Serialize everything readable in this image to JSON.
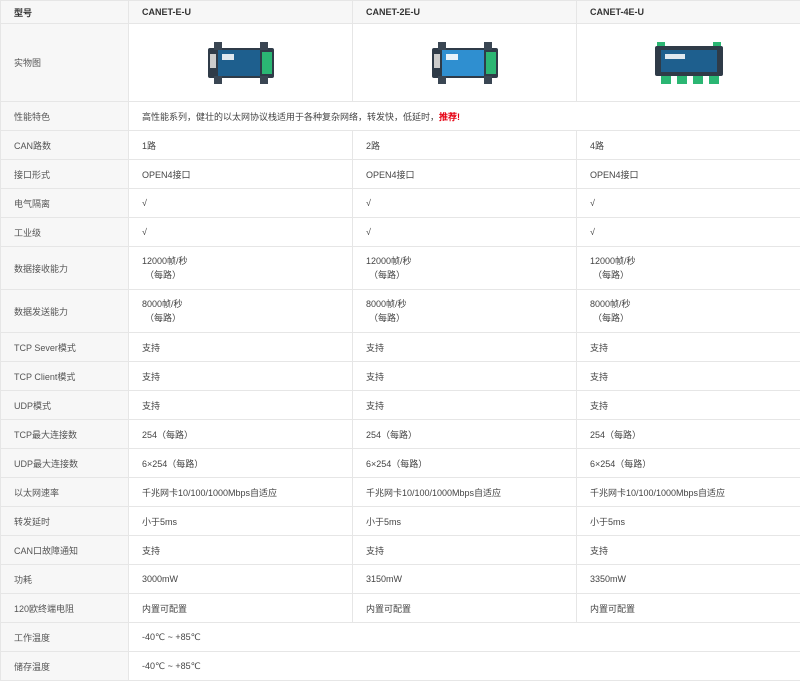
{
  "header": {
    "label": "型号",
    "models": [
      "CANET-E-U",
      "CANET-2E-U",
      "CANET-4E-U"
    ]
  },
  "rows": {
    "photo": {
      "label": "实物图"
    },
    "feature": {
      "label": "性能特色",
      "text": "高性能系列，健壮的以太网协议栈适用于各种复杂网络，转发快，低延时，",
      "highlight": "推荐!"
    },
    "can_channels": {
      "label": "CAN路数",
      "values": [
        "1路",
        "2路",
        "4路"
      ]
    },
    "interface": {
      "label": "接口形式",
      "values": [
        "OPEN4接口",
        "OPEN4接口",
        "OPEN4接口"
      ]
    },
    "isolation": {
      "label": "电气隔离",
      "values": [
        "√",
        "√",
        "√"
      ]
    },
    "industrial": {
      "label": "工业级",
      "values": [
        "√",
        "√",
        "√"
      ]
    },
    "rx": {
      "label": "数据接收能力",
      "values": [
        "12000帧/秒",
        "12000帧/秒",
        "12000帧/秒"
      ],
      "sub": "（每路）"
    },
    "tx": {
      "label": "数据发送能力",
      "values": [
        "8000帧/秒",
        "8000帧/秒",
        "8000帧/秒"
      ],
      "sub": "（每路）"
    },
    "tcp_server": {
      "label": "TCP Sever模式",
      "values": [
        "支持",
        "支持",
        "支持"
      ]
    },
    "tcp_client": {
      "label": "TCP Client模式",
      "values": [
        "支持",
        "支持",
        "支持"
      ]
    },
    "udp": {
      "label": "UDP模式",
      "values": [
        "支持",
        "支持",
        "支持"
      ]
    },
    "tcp_max": {
      "label": "TCP最大连接数",
      "values": [
        "254（每路）",
        "254（每路）",
        "254（每路）"
      ]
    },
    "udp_max": {
      "label": "UDP最大连接数",
      "values": [
        "6×254（每路）",
        "6×254（每路）",
        "6×254（每路）"
      ]
    },
    "eth_speed": {
      "label": "以太网速率",
      "values": [
        "千兆网卡10/100/1000Mbps自适应",
        "千兆网卡10/100/1000Mbps自适应",
        "千兆网卡10/100/1000Mbps自适应"
      ]
    },
    "latency": {
      "label": "转发延时",
      "values": [
        "小于5ms",
        "小于5ms",
        "小于5ms"
      ]
    },
    "fault": {
      "label": "CAN口故障通知",
      "values": [
        "支持",
        "支持",
        "支持"
      ]
    },
    "power": {
      "label": "功耗",
      "values": [
        "3000mW",
        "3150mW",
        "3350mW"
      ]
    },
    "termination": {
      "label": "120欧终端电阻",
      "values": [
        "内置可配置",
        "内置可配置",
        "内置可配置"
      ]
    },
    "op_temp": {
      "label": "工作温度",
      "value": "-40℃ ~ +85℃"
    },
    "storage_temp": {
      "label": "储存温度",
      "value": "-40℃ ~ +85℃"
    }
  },
  "colors": {
    "highlight": "#e60012",
    "device_blue": "#1e5f8e",
    "device_frame": "#2f3b48",
    "terminal_green": "#2bb673"
  }
}
